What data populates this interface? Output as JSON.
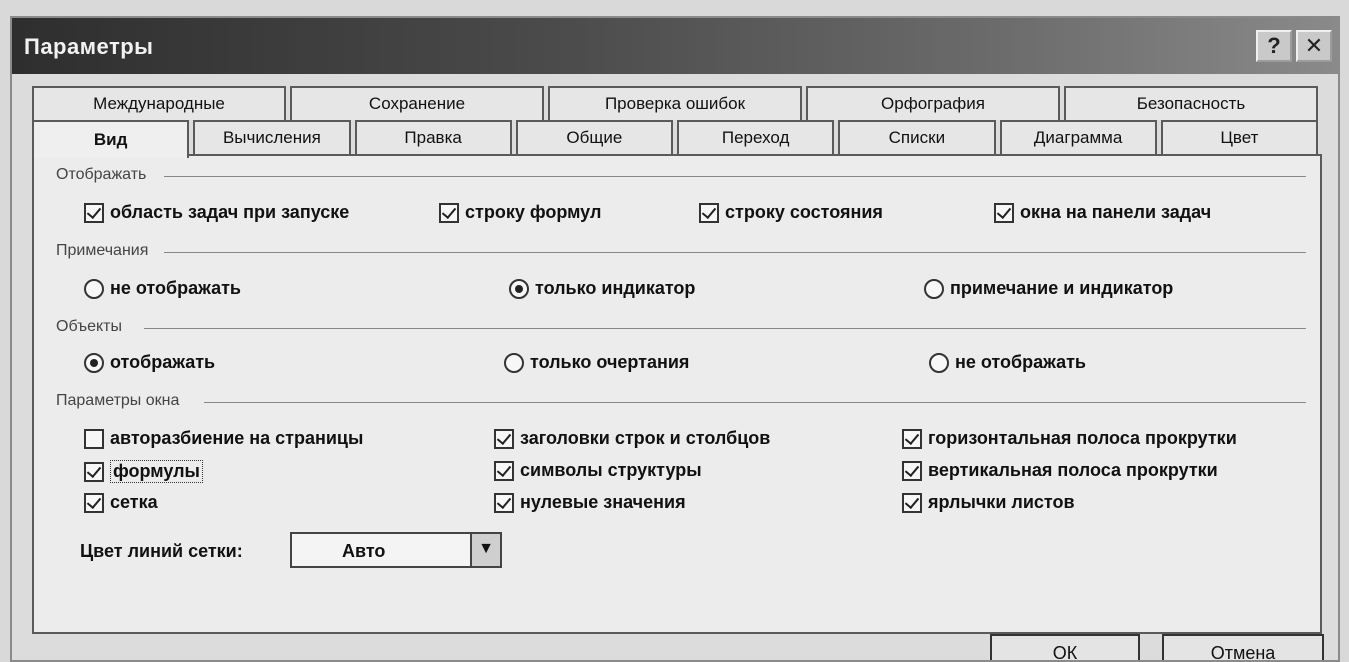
{
  "window": {
    "title": "Параметры"
  },
  "titlebar": {
    "help_label": "?",
    "close_label": "✕"
  },
  "tabs": {
    "row_back": [
      "Международные",
      "Сохранение",
      "Проверка ошибок",
      "Орфография",
      "Безопасность"
    ],
    "row_front": [
      "Вид",
      "Вычисления",
      "Правка",
      "Общие",
      "Переход",
      "Списки",
      "Диаграмма",
      "Цвет"
    ],
    "active": "Вид"
  },
  "show": {
    "label": "Отображать",
    "items": [
      {
        "label": "область задач при запуске",
        "checked": true
      },
      {
        "label": "строку формул",
        "checked": true
      },
      {
        "label": "строку состояния",
        "checked": true
      },
      {
        "label": "окна на панели задач",
        "checked": true
      }
    ]
  },
  "notes": {
    "label": "Примечания",
    "options": [
      {
        "label": "не отображать",
        "selected": false
      },
      {
        "label": "только индикатор",
        "selected": true
      },
      {
        "label": "примечание и индикатор",
        "selected": false
      }
    ]
  },
  "objects": {
    "label": "Объекты",
    "options": [
      {
        "label": "отображать",
        "selected": true
      },
      {
        "label": "только очертания",
        "selected": false
      },
      {
        "label": "не отображать",
        "selected": false
      }
    ]
  },
  "window_params": {
    "label": "Параметры окна",
    "items": [
      {
        "label": "авторазбиение на страницы",
        "checked": false
      },
      {
        "label": "заголовки строк и столбцов",
        "checked": true
      },
      {
        "label": "горизонтальная полоса прокрутки",
        "checked": true
      },
      {
        "label": "формулы",
        "checked": true
      },
      {
        "label": "символы структуры",
        "checked": true
      },
      {
        "label": "вертикальная полоса прокрутки",
        "checked": true
      },
      {
        "label": "сетка",
        "checked": true
      },
      {
        "label": "нулевые значения",
        "checked": true
      },
      {
        "label": "ярлычки листов",
        "checked": true
      }
    ]
  },
  "grid_color": {
    "label": "Цвет линий сетки:",
    "value": "Авто"
  },
  "buttons": {
    "ok": "ОК",
    "cancel": "Отмена"
  }
}
